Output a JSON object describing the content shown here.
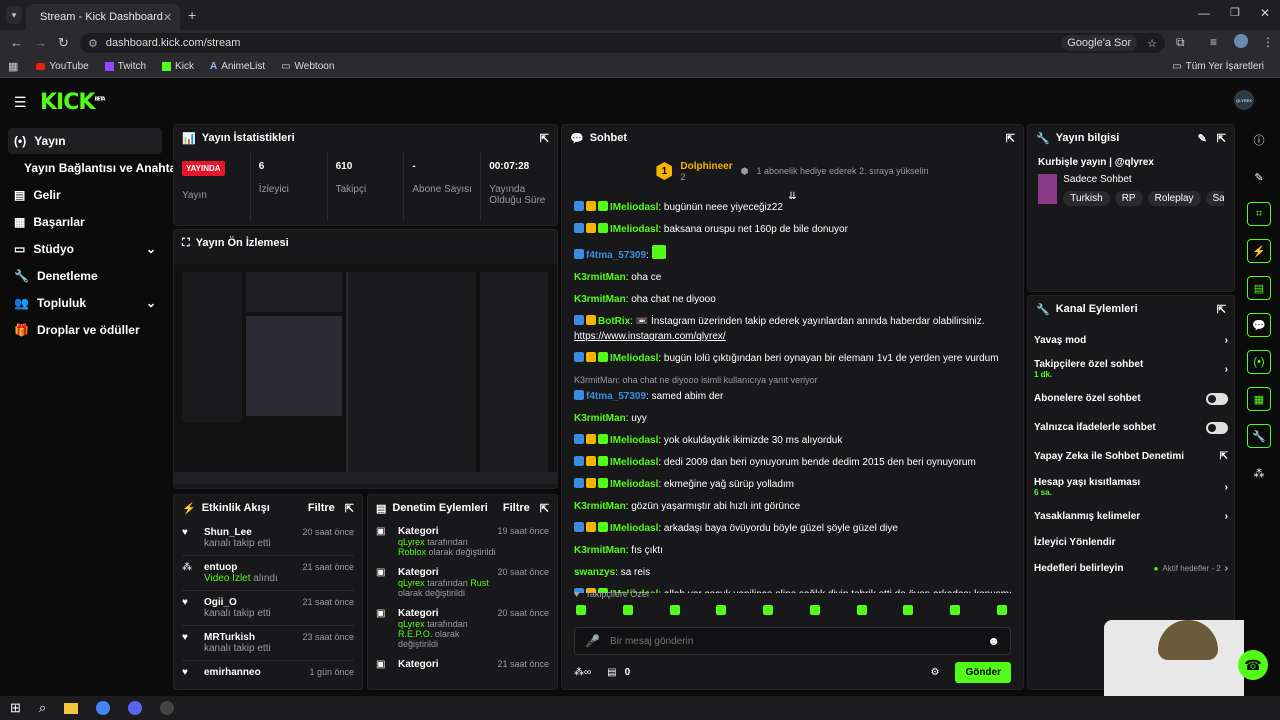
{
  "browser": {
    "tab_title": "Stream - Kick Dashboard",
    "url": "dashboard.kick.com/stream",
    "google_btn": "Google'a Sor",
    "bookmarks": [
      "YouTube",
      "Twitch",
      "Kick",
      "AnimeList",
      "Webtoon"
    ],
    "all_bookmarks": "Tüm Yer İşaretleri"
  },
  "app": {
    "logo": "KICK",
    "logo_sup": "BETA",
    "avatar": "QLYREX"
  },
  "sidebar": {
    "items": [
      {
        "label": "Yayın",
        "icon": "broadcast-icon"
      },
      {
        "label": "Yayın Bağlantısı ve Anahtarı"
      },
      {
        "label": "Gelir"
      },
      {
        "label": "Başarılar"
      },
      {
        "label": "Stüdyo"
      },
      {
        "label": "Denetleme"
      },
      {
        "label": "Topluluk"
      },
      {
        "label": "Droplar ve ödüller"
      }
    ]
  },
  "stats": {
    "title": "Yayın İstatistikleri",
    "live_badge": "YAYINDA",
    "live_label": "Yayın",
    "items": [
      {
        "value": "6",
        "label": "İzleyici"
      },
      {
        "value": "610",
        "label": "Takipçi"
      },
      {
        "value": "-",
        "label": "Abone Sayısı"
      },
      {
        "value": "00:07:28",
        "label": "Yayında Olduğu Süre"
      }
    ]
  },
  "preview": {
    "title": "Yayın Ön İzlemesi"
  },
  "activity": {
    "title": "Etkinlik Akışı",
    "filter": "Filtre",
    "items": [
      {
        "user": "Shun_Lee",
        "text": "kanalı takip etti",
        "time": "20 saat önce"
      },
      {
        "user": "entuop",
        "text_green": "Video İzlet",
        "text": "alındı",
        "time": "21 saat önce"
      },
      {
        "user": "Ogii_O",
        "text": "kanalı takip etti",
        "time": "21 saat önce"
      },
      {
        "user": "MRTurkish",
        "text": "kanalı takip etti",
        "time": "23 saat önce"
      },
      {
        "user": "emirhanneo",
        "text": "",
        "time": "1 gün önce"
      }
    ]
  },
  "moderation": {
    "title": "Denetim Eylemleri",
    "filter": "Filtre",
    "items": [
      {
        "title": "Kategori",
        "time": "19 saat önce",
        "by": "qLyrex",
        "mid": "tarafından",
        "cat": "Roblox",
        "end": "olarak değiştirildi"
      },
      {
        "title": "Kategori",
        "time": "20 saat önce",
        "by": "qLyrex",
        "mid": "tarafından",
        "cat": "Rust",
        "end": "olarak değiştirildi"
      },
      {
        "title": "Kategori",
        "time": "20 saat önce",
        "by": "qLyrex",
        "mid": "tarafından",
        "cat": "R.E.P.O.",
        "end": "olarak değiştirildi"
      },
      {
        "title": "Kategori",
        "time": "21 saat önce",
        "by": "",
        "mid": "",
        "cat": "",
        "end": ""
      }
    ]
  },
  "chat": {
    "title": "Sohbet",
    "pinned_user": "Dolphineer",
    "pinned_num": "1",
    "pinned_count": "2",
    "pinned_text": "1 abonelik hediye ederek 2. sıraya yükselin",
    "messages": [
      {
        "user": "IMeliodasl",
        "color": "#53fc18",
        "badges": 3,
        "text": "bugünün neee yiyeceğiz22"
      },
      {
        "user": "IMeliodasl",
        "color": "#53fc18",
        "badges": 3,
        "text": "baksana oruspu net 160p de bile donuyor"
      },
      {
        "user": "f4tma_57309",
        "color": "#3a8dde",
        "badges": 1,
        "text": ""
      },
      {
        "user": "K3rmitMan",
        "color": "#53fc18",
        "badges": 0,
        "text": "oha ce"
      },
      {
        "user": "K3rmitMan",
        "color": "#53fc18",
        "badges": 0,
        "text": "oha chat ne diyooo"
      },
      {
        "user": "BotRix",
        "color": "#53fc18",
        "badges": 2,
        "text": "📼 İnstagram üzerinden takip ederek yayınlardan anında haberdar olabilirsiniz."
      },
      {
        "user": "",
        "color": "#fff",
        "badges": 0,
        "text": "https://www.instagram.com/qlyrex/"
      },
      {
        "user": "IMeliodasl",
        "color": "#53fc18",
        "badges": 3,
        "text": "bugün lolü çıktığından beri oynayan bir elemanı 1v1 de yerden yere vurdum"
      },
      {
        "user": "f4tma_57309",
        "color": "#3a8dde",
        "badges": 1,
        "text": "samed abim der"
      },
      {
        "user": "K3rmitMan",
        "color": "#53fc18",
        "badges": 0,
        "text": "uyy"
      },
      {
        "user": "IMeliodasl",
        "color": "#53fc18",
        "badges": 3,
        "text": "yok okuldaydık ikimizde 30 ms alıyorduk"
      },
      {
        "user": "IMeliodasl",
        "color": "#53fc18",
        "badges": 3,
        "text": "dedi 2009 dan beri oynuyorum bende dedim 2015 den beri oynuyorum"
      },
      {
        "user": "IMeliodasl",
        "color": "#53fc18",
        "badges": 3,
        "text": "ekmeğine yağ sürüp yolladım"
      },
      {
        "user": "K3rmitMan",
        "color": "#53fc18",
        "badges": 0,
        "text": "gözün yaşarmıştır abi hızlı int görünce"
      },
      {
        "user": "IMeliodasl",
        "color": "#53fc18",
        "badges": 3,
        "text": "arkadaşı baya övüyordu böyle güzel şöyle güzel diye"
      },
      {
        "user": "K3rmitMan",
        "color": "#53fc18",
        "badges": 0,
        "text": "fıs çıktı"
      },
      {
        "user": "swanzys",
        "color": "#53fc18",
        "badges": 0,
        "text": "sa reis"
      },
      {
        "user": "IMeliodasl",
        "color": "#53fc18",
        "badges": 3,
        "text": "allah var çocuk yenilince eline sağlık diyip tebrik etti de öven arkadaşı konuşmadı"
      },
      {
        "user": "",
        "color": "#fff",
        "badges": 0,
        "text": "OŞXDIFJGOXIHR"
      }
    ],
    "reply_note": "K3rmitMan: oha chat ne diyooo isimli kullanıcıya yanıt veriyor",
    "followers_only": "Takipçilere Özel",
    "placeholder": "Bir mesaj gönderin",
    "points": "0",
    "send": "Gönder"
  },
  "info": {
    "title": "Yayın bilgisi",
    "stream_title": "Kurbişle yayın | @qlyrex",
    "category": "Sadece Sohbet",
    "tags": [
      "Turkish",
      "RP",
      "Roleplay",
      "Satis"
    ]
  },
  "channel": {
    "title": "Kanal Eylemleri",
    "items": [
      {
        "label": "Yavaş mod",
        "sub": "",
        "ctrl": "chevron"
      },
      {
        "label": "Takipçilere özel sohbet",
        "sub": "1 dk.",
        "ctrl": "chevron"
      },
      {
        "label": "Abonelere özel sohbet",
        "sub": "",
        "ctrl": "toggle"
      },
      {
        "label": "Yalnızca ifadelerle sohbet",
        "sub": "",
        "ctrl": "toggle"
      },
      {
        "label": "Yapay Zeka ile Sohbet Denetimi",
        "sub": "",
        "ctrl": "external"
      },
      {
        "label": "Hesap yaşı kısıtlaması",
        "sub": "6 sa.",
        "ctrl": "chevron"
      },
      {
        "label": "Yasaklanmış kelimeler",
        "sub": "",
        "ctrl": "chevron"
      },
      {
        "label": "İzleyici Yönlendir",
        "sub": "",
        "ctrl": ""
      },
      {
        "label": "Hedefleri belirleyin",
        "sub": "",
        "ctrl": "chevron",
        "extra": "Aktif hedefler - 2"
      }
    ]
  }
}
